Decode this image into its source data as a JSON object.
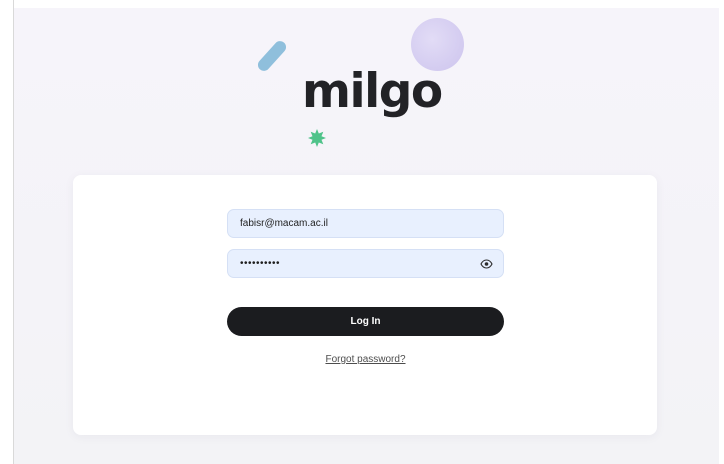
{
  "brand": {
    "logo_text": "milgo"
  },
  "login_form": {
    "email_value": "fabisr@macam.ac.il",
    "password_value": "••••••••••",
    "login_label": "Log In",
    "forgot_label": "Forgot password?"
  },
  "colors": {
    "background": "#f5f4f9",
    "card": "#ffffff",
    "input_fill": "#e8f0fe",
    "button": "#1b1c1f",
    "deco_pill": "#8fbfdc",
    "deco_circle": "#d3cbf0",
    "deco_star": "#4fc38a"
  },
  "icons": {
    "password_toggle": "eye-icon",
    "decorations": [
      "pill-shape",
      "circle-shape",
      "star-burst-icon"
    ]
  }
}
